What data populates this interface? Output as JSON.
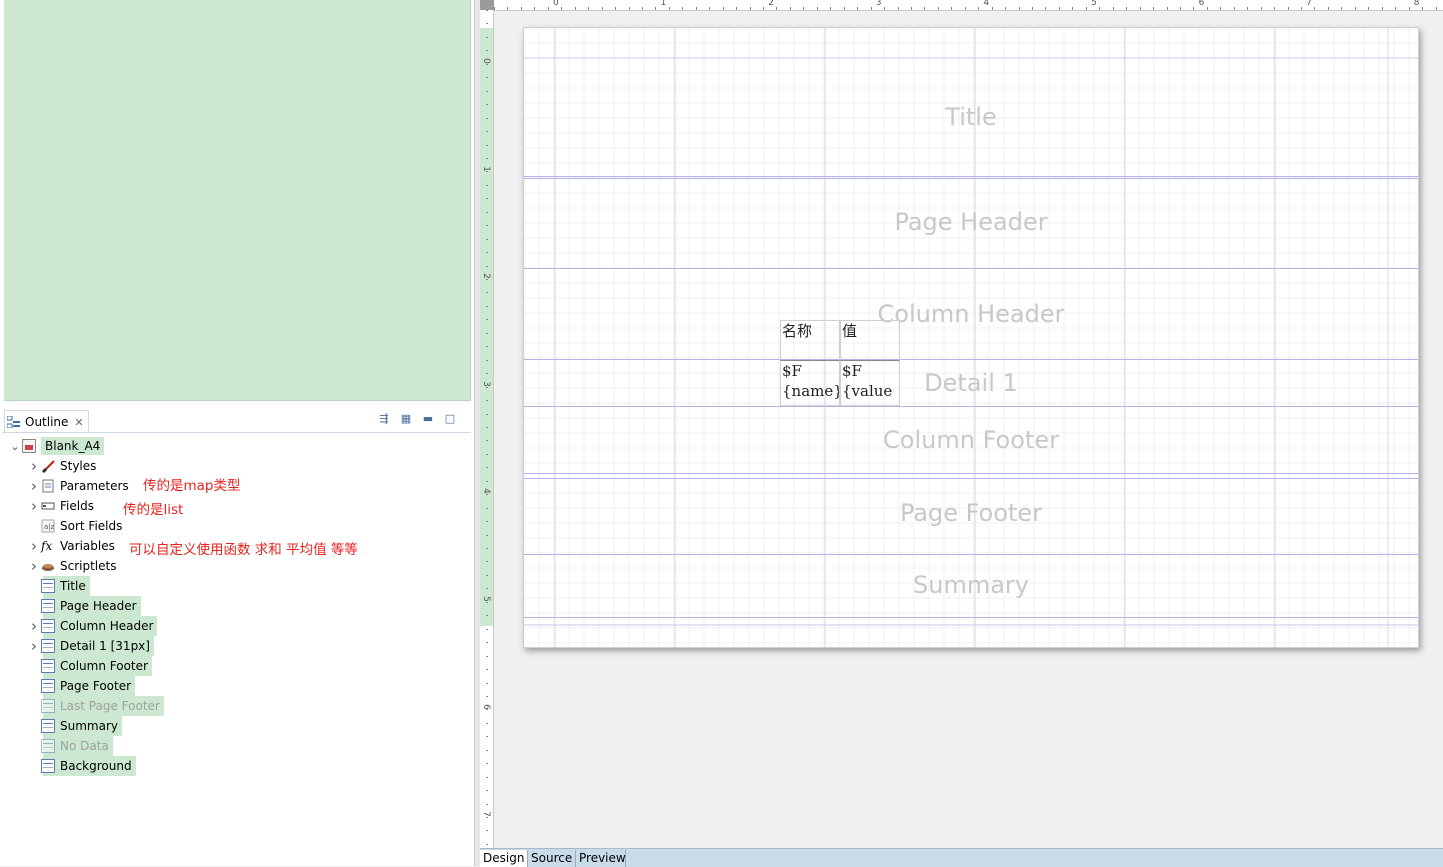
{
  "outline": {
    "tab_label": "Outline",
    "root": "Blank_A4",
    "items": [
      {
        "label": "Styles",
        "expandable": true,
        "icon": "brush-icon"
      },
      {
        "label": "Parameters",
        "expandable": true,
        "icon": "parameters-icon"
      },
      {
        "label": "Fields",
        "expandable": true,
        "icon": "fields-icon"
      },
      {
        "label": "Sort Fields",
        "expandable": false,
        "icon": "sort-fields-icon"
      },
      {
        "label": "Variables",
        "expandable": true,
        "icon": "fx-icon"
      },
      {
        "label": "Scriptlets",
        "expandable": true,
        "icon": "coffee-icon"
      },
      {
        "label": "Title",
        "expandable": false,
        "icon": "band-icon"
      },
      {
        "label": "Page Header",
        "expandable": false,
        "icon": "band-icon"
      },
      {
        "label": "Column Header",
        "expandable": true,
        "icon": "band-icon"
      },
      {
        "label": "Detail 1 [31px]",
        "expandable": true,
        "icon": "band-icon"
      },
      {
        "label": "Column Footer",
        "expandable": false,
        "icon": "band-icon"
      },
      {
        "label": "Page Footer",
        "expandable": false,
        "icon": "band-icon"
      },
      {
        "label": "Last Page Footer",
        "expandable": false,
        "icon": "band-icon",
        "disabled": true
      },
      {
        "label": "Summary",
        "expandable": false,
        "icon": "band-icon"
      },
      {
        "label": "No Data",
        "expandable": false,
        "icon": "band-icon",
        "disabled": true
      },
      {
        "label": "Background",
        "expandable": false,
        "icon": "band-icon"
      }
    ],
    "notes": {
      "parameters": "传的是map类型",
      "fields": "传的是list",
      "variables": "可以自定义使用函数  求和 平均值 等等"
    }
  },
  "ruler": {
    "h_numbers": [
      "0",
      "1",
      "2",
      "3",
      "4",
      "5",
      "6",
      "7",
      "8"
    ],
    "v_numbers": [
      "0",
      "1",
      "2",
      "3",
      "4",
      "5",
      "6",
      "7"
    ]
  },
  "report": {
    "bands": [
      "Title",
      "Page Header",
      "Column Header",
      "Detail 1",
      "Column Footer",
      "Page Footer",
      "Summary"
    ],
    "column_headers": [
      "名称",
      "值"
    ],
    "detail_fields": [
      [
        "$F",
        "{name}"
      ],
      [
        "$F",
        "{value"
      ]
    ]
  },
  "bottom_tabs": [
    "Design",
    "Source",
    "Preview"
  ],
  "colors": {
    "selection_green": "#cce8d0",
    "note_red": "#e8231f",
    "band_label": "#c8c8c8"
  }
}
